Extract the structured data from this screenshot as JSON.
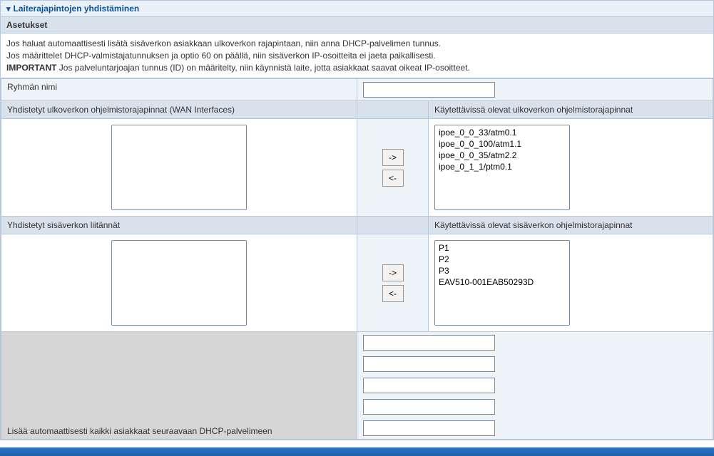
{
  "section_title": "Laiterajapintojen yhdistäminen",
  "settings_label": "Asetukset",
  "info": {
    "line1": "Jos haluat automaattisesti lisätä sisäverkon asiakkaan ulkoverkon rajapintaan, niin anna DHCP-palvelimen tunnus.",
    "line2": "Jos määrittelet DHCP-valmistajatunnuksen ja optio 60 on päällä, niin sisäverkon IP-osoitteita ei jaeta paikallisesti.",
    "important_label": "IMPORTANT",
    "line3": " Jos palveluntarjoajan tunnus (ID) on määritelty, niin käynnistä laite, jotta asiakkaat saavat oikeat IP-osoitteet."
  },
  "group_name": {
    "label": "Ryhmän nimi",
    "value": ""
  },
  "wan": {
    "grouped_label": "Yhdistetyt ulkoverkon ohjelmistorajapinnat (WAN Interfaces)",
    "available_label": "Käytettävissä olevat ulkoverkon ohjelmistorajapinnat",
    "grouped_items": [],
    "available_items": [
      "ipoe_0_0_33/atm0.1",
      "ipoe_0_0_100/atm1.1",
      "ipoe_0_0_35/atm2.2",
      "ipoe_0_1_1/ptm0.1"
    ]
  },
  "lan": {
    "grouped_label": "Yhdistetyt sisäverkon liitännät",
    "available_label": "Käytettävissä olevat sisäverkon ohjelmistorajapinnat",
    "grouped_items": [],
    "available_items": [
      "P1",
      "P2",
      "P3",
      "EAV510-001EAB50293D"
    ]
  },
  "buttons": {
    "move_right": "->",
    "move_left": "<-"
  },
  "dhcp": {
    "label": "Lisää automaattisesti kaikki asiakkaat seuraavaan DHCP-palvelimeen",
    "values": [
      "",
      "",
      "",
      "",
      ""
    ]
  }
}
